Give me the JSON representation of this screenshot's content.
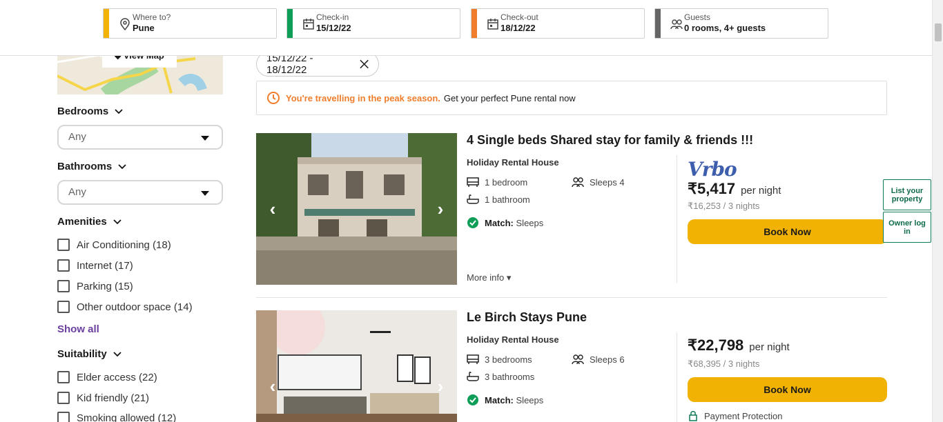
{
  "search": {
    "where": {
      "label": "Where to?",
      "value": "Pune",
      "color": "#f2b203"
    },
    "checkin": {
      "label": "Check-in",
      "value": "15/12/22",
      "color": "#0e9e57"
    },
    "checkout": {
      "label": "Check-out",
      "value": "18/12/22",
      "color": "#f07d2b"
    },
    "guests": {
      "label": "Guests",
      "value": "0 rooms, 4+ guests",
      "color": "#666666"
    }
  },
  "sidebar": {
    "map_button": "View Map",
    "bedrooms": {
      "title": "Bedrooms",
      "value": "Any"
    },
    "bathrooms": {
      "title": "Bathrooms",
      "value": "Any"
    },
    "amenities": {
      "title": "Amenities",
      "items": [
        "Air Conditioning (18)",
        "Internet (17)",
        "Parking (15)",
        "Other outdoor space (14)"
      ],
      "show_all": "Show all"
    },
    "suitability": {
      "title": "Suitability",
      "items": [
        "Elder access (22)",
        "Kid friendly (21)",
        "Smoking allowed (12)"
      ]
    }
  },
  "filter_chip": "15/12/22 - 18/12/22",
  "banner": {
    "warning": "You're travelling in the peak season.",
    "text": "Get your perfect Pune rental now"
  },
  "listings": [
    {
      "title": "4 Single beds Shared stay for family & friends !!!",
      "type": "Holiday Rental House",
      "bedrooms": "1 bedroom",
      "bathrooms": "1 bathroom",
      "sleeps": "Sleeps 4",
      "match_label": "Match:",
      "match_value": "Sleeps",
      "provider": "Vrbo",
      "price": "₹5,417",
      "per_night": "per night",
      "total": "₹16,253 / 3 nights",
      "book": "Book Now",
      "more_info": "More info"
    },
    {
      "title": "Le Birch Stays Pune",
      "type": "Holiday Rental House",
      "bedrooms": "3 bedrooms",
      "bathrooms": "3 bathrooms",
      "sleeps": "Sleeps 6",
      "match_label": "Match:",
      "match_value": "Sleeps",
      "price": "₹22,798",
      "per_night": "per night",
      "total": "₹68,395 / 3 nights",
      "book": "Book Now",
      "payment": "Payment Protection"
    }
  ],
  "side_buttons": {
    "list_property": "List your property",
    "owner_login": "Owner log in"
  }
}
